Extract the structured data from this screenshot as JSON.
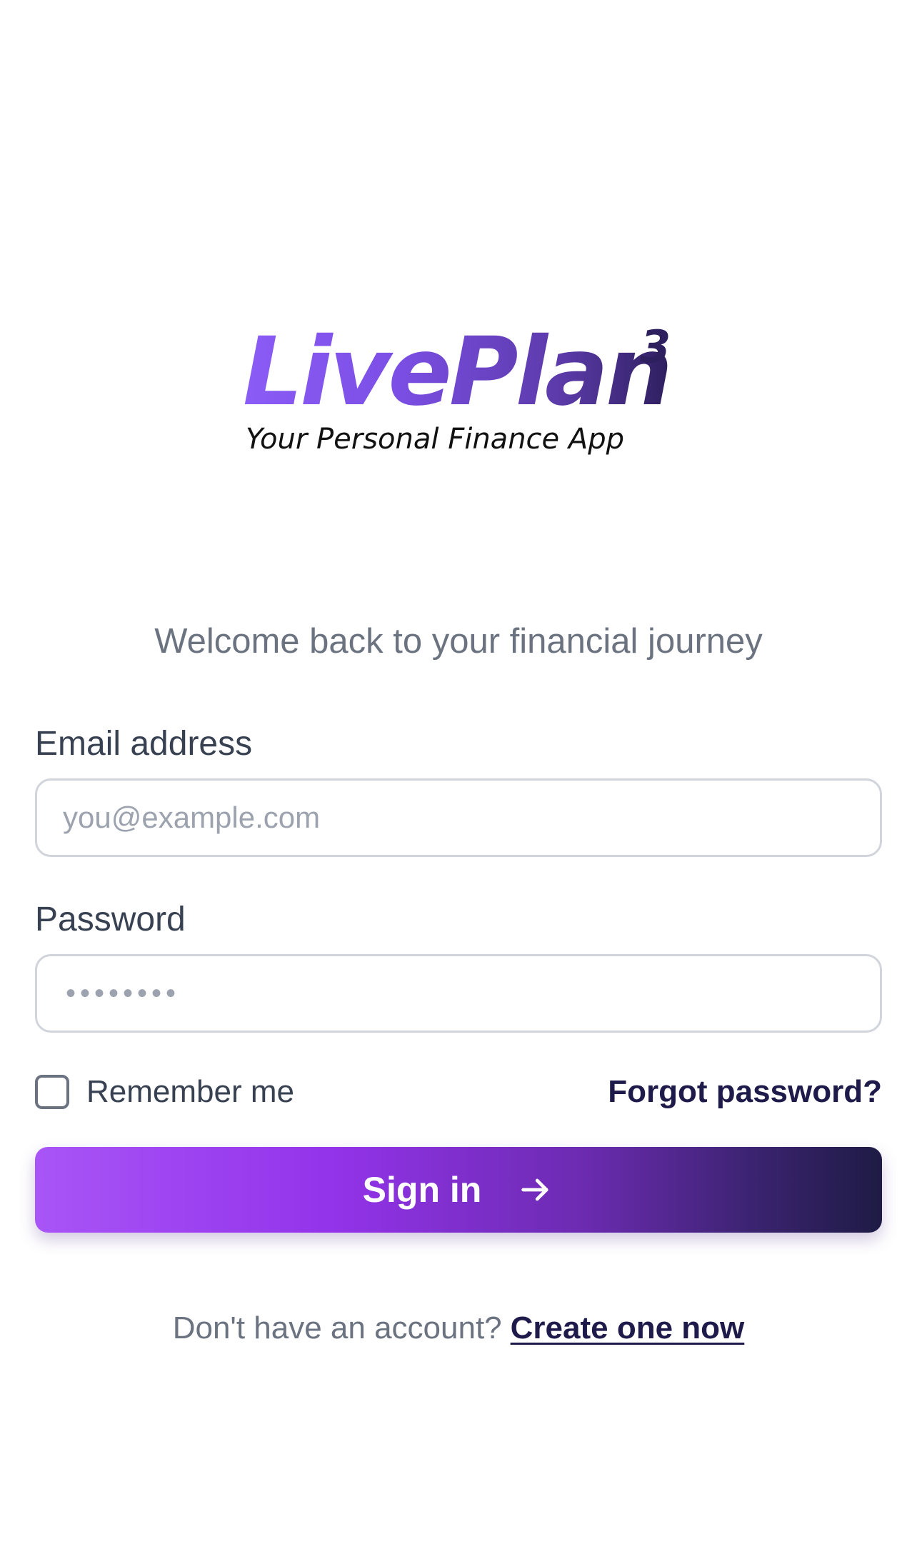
{
  "logo": {
    "title": "LivePlan",
    "superscript": "3",
    "tagline": "Your Personal Finance App"
  },
  "welcome_text": "Welcome back to your financial journey",
  "form": {
    "email": {
      "label": "Email address",
      "placeholder": "you@example.com",
      "value": ""
    },
    "password": {
      "label": "Password",
      "masked_value": "••••••••"
    },
    "remember_me": {
      "label": "Remember me",
      "checked": false
    },
    "forgot_password_label": "Forgot password?",
    "submit_label": "Sign in",
    "submit_icon": "arrow-right-icon"
  },
  "signup": {
    "prompt": "Don't have an account?",
    "link_label": "Create one now"
  },
  "colors": {
    "brand_light": "#8b5cf6",
    "brand_dark": "#2e1f5e",
    "button_gradient_start": "#a855f7",
    "button_gradient_end": "#1e1b45",
    "link": "#1e1b4b",
    "muted_text": "#6b7280"
  }
}
